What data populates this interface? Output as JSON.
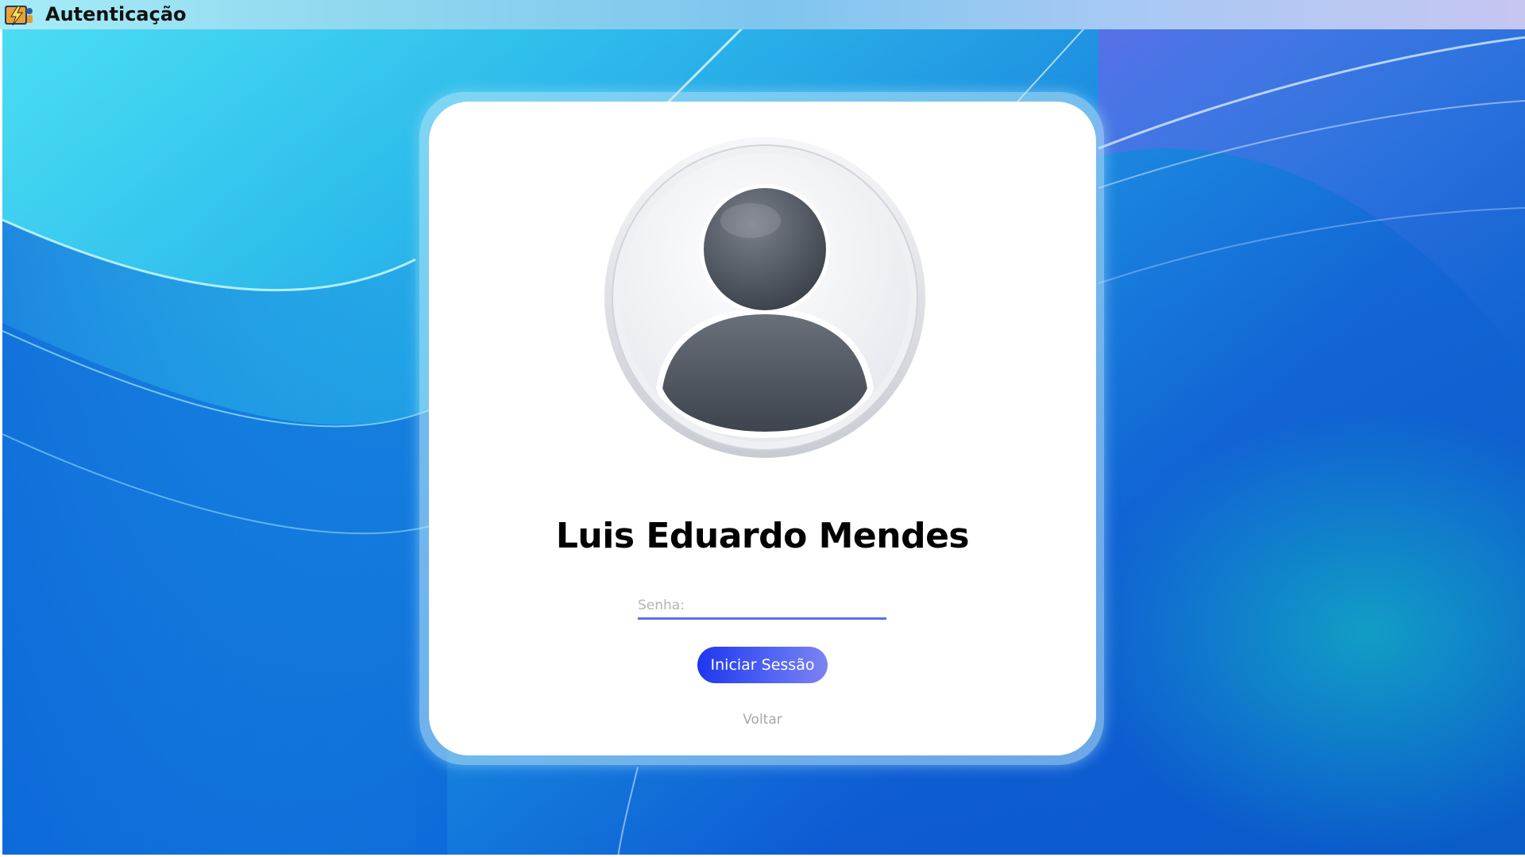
{
  "window": {
    "title": "Autenticação",
    "icon": "app-logo-icon"
  },
  "login": {
    "user_name": "Luis Eduardo Mendes",
    "avatar_icon": "user-avatar-icon",
    "password_placeholder": "Senha:",
    "password_value": "",
    "submit_label": "Iniciar Sessão",
    "back_label": "Voltar"
  },
  "colors": {
    "accent": "#4f63f4",
    "input_underline": "#5b6ef0",
    "muted_text": "#a8a8a8"
  }
}
